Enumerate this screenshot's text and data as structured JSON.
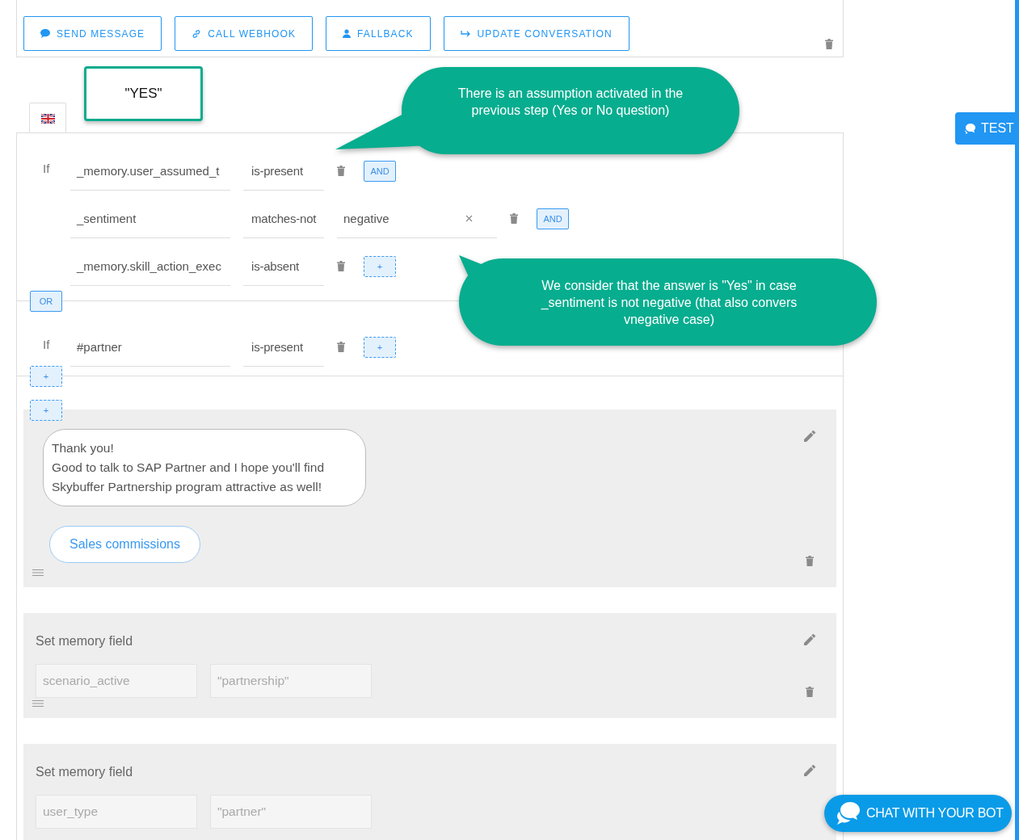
{
  "toolbar": {
    "buttons": [
      {
        "label": "SEND MESSAGE"
      },
      {
        "label": "CALL WEBHOOK"
      },
      {
        "label": "FALLBACK"
      },
      {
        "label": "UPDATE CONVERSATION"
      }
    ]
  },
  "yes_note": "\"YES\"",
  "callouts": [
    {
      "text": "There is an assumption activated in the previous step (Yes or No question)"
    },
    {
      "text": "We consider that the answer is \"Yes\" in case _sentiment is not negative (that also convers vnegative case)"
    }
  ],
  "conditions": {
    "groups": [
      {
        "rows": [
          {
            "prefix": "If",
            "field": "_memory.user_assumed_t",
            "operator": "is-present",
            "next": {
              "kind": "and",
              "label": "AND"
            }
          },
          {
            "field": "_sentiment",
            "operator": "matches-not",
            "value": "negative",
            "next": {
              "kind": "and",
              "label": "AND"
            }
          },
          {
            "field": "_memory.skill_action_exec",
            "operator": "is-absent",
            "next": {
              "kind": "add",
              "label": "+"
            }
          }
        ]
      },
      {
        "rows": [
          {
            "prefix": "If",
            "field": "#partner",
            "operator": "is-present",
            "next": {
              "kind": "add",
              "label": "+"
            }
          }
        ]
      }
    ],
    "or_label": "OR",
    "add_group_label": "+"
  },
  "add_action_label": "+",
  "actions": [
    {
      "kind": "message",
      "lines": [
        "Thank you!",
        "Good to talk to SAP Partner and I hope you'll find",
        "Skybuffer Partnership program attractive as well!"
      ],
      "quick_reply": "Sales commissions",
      "deletable": true
    },
    {
      "kind": "memory",
      "title": "Set memory field",
      "key": "scenario_active",
      "value": "\"partnership\"",
      "deletable": true
    },
    {
      "kind": "memory",
      "title": "Set memory field",
      "key": "user_type",
      "value": "\"partner\"",
      "deletable": false
    }
  ],
  "test_button": "TEST",
  "chat_button": "CHAT WITH YOUR BOT"
}
